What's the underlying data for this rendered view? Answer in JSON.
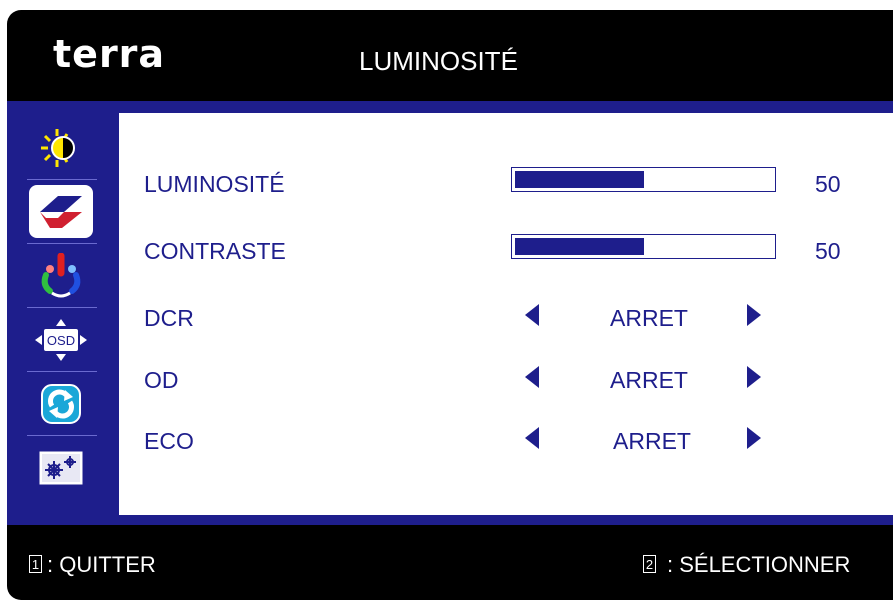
{
  "header": {
    "logo": "terra",
    "title": "LUMINOSITÉ"
  },
  "sidebar": {
    "items": [
      {
        "icon": "brightness-icon",
        "active": false
      },
      {
        "icon": "image-setup-icon",
        "active": true
      },
      {
        "icon": "color-setup-icon",
        "active": false
      },
      {
        "icon": "osd-setup-icon",
        "active": false
      },
      {
        "icon": "reset-icon",
        "active": false
      },
      {
        "icon": "extra-settings-icon",
        "active": false
      }
    ],
    "osd_icon_label": "OSD"
  },
  "settings": {
    "brightness": {
      "label": "LUMINOSITÉ",
      "value": "50",
      "level": 0.5
    },
    "contrast": {
      "label": "CONTRASTE",
      "value": "50",
      "level": 0.5
    },
    "dcr": {
      "label": "DCR",
      "value": "ARRET"
    },
    "od": {
      "label": "OD",
      "value": "ARRET"
    },
    "eco": {
      "label": "ECO",
      "value": "ARRET"
    }
  },
  "footer": {
    "key1": "1",
    "key1_label": ": QUITTER",
    "key2": "2",
    "key2_label": ": SÉLECTIONNER"
  },
  "colors": {
    "accent": "#1e1e8c",
    "background": "#000000",
    "panel": "#ffffff"
  }
}
